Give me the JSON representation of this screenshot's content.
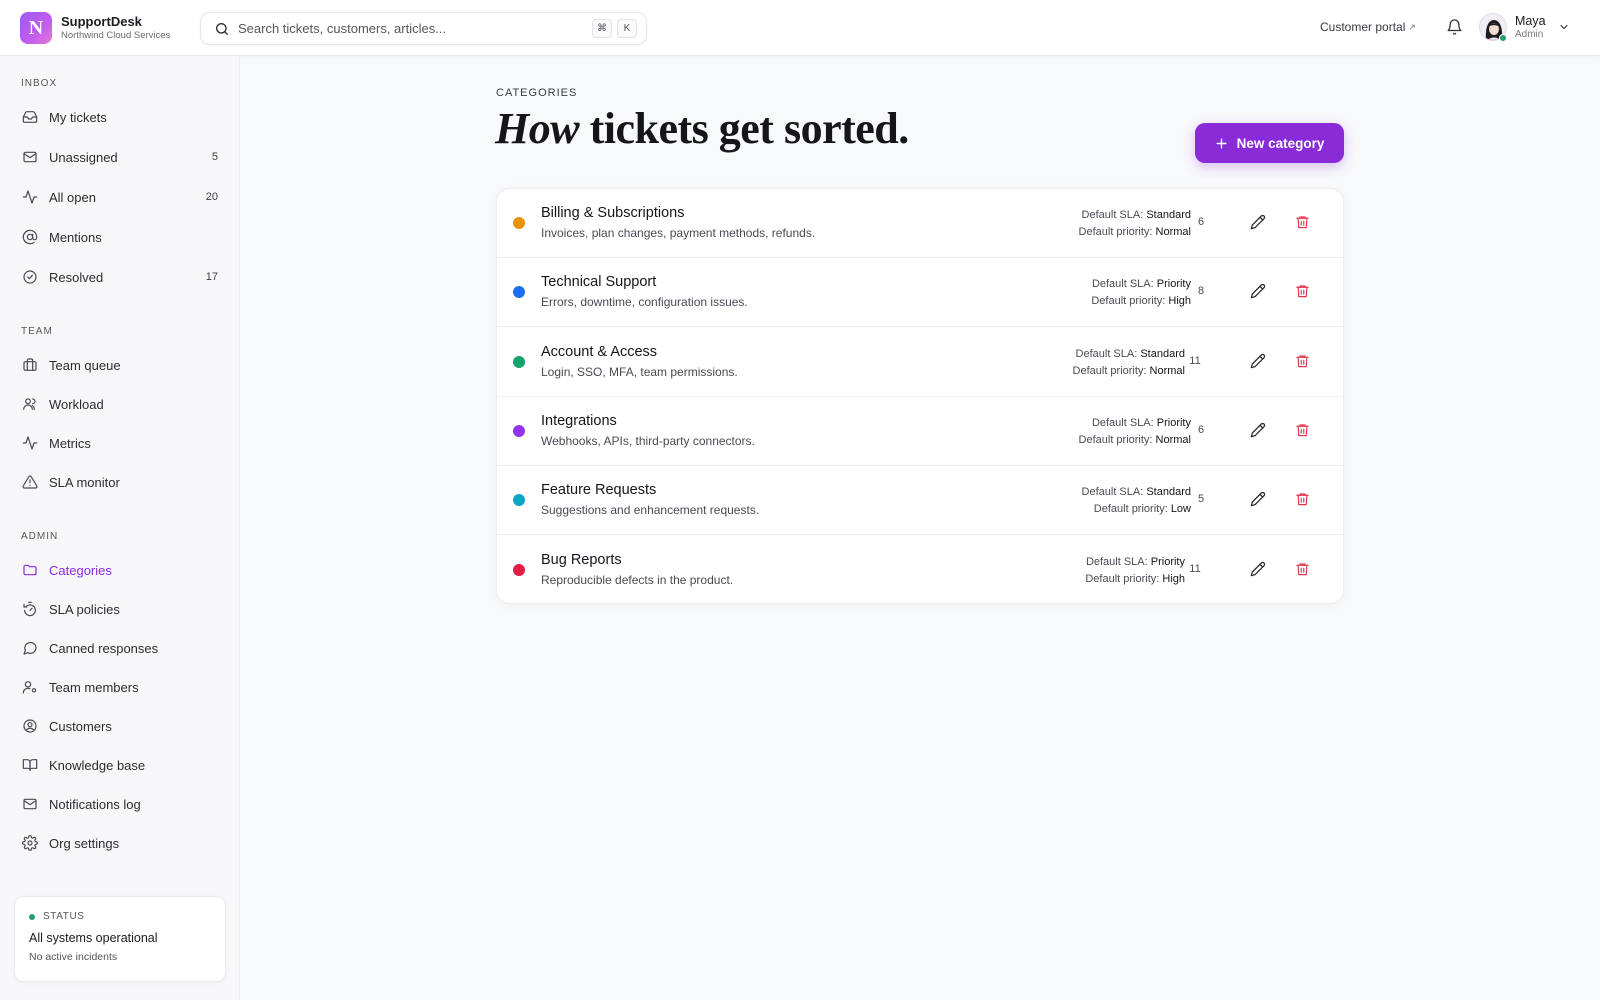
{
  "brand": {
    "logo_letter": "N",
    "name": "SupportDesk",
    "org": "Northwind Cloud Services"
  },
  "search": {
    "placeholder": "Search tickets, customers, articles...",
    "shortcut_cmd": "⌘",
    "shortcut_key": "K"
  },
  "header": {
    "portal_label": "Customer portal",
    "portal_icon": "external-link-arrow",
    "user": {
      "name": "Maya",
      "role": "Admin",
      "online_color": "#22a06b"
    }
  },
  "sidebar": {
    "inbox_label": "INBOX",
    "inbox": [
      {
        "label": "My tickets",
        "icon": "inbox-icon",
        "count": ""
      },
      {
        "label": "Unassigned",
        "icon": "mail-icon",
        "count": "5"
      },
      {
        "label": "All open",
        "icon": "activity-icon",
        "count": "20"
      },
      {
        "label": "Mentions",
        "icon": "at-sign-icon",
        "count": ""
      },
      {
        "label": "Resolved",
        "icon": "check-circle-icon",
        "count": "17"
      }
    ],
    "team_label": "TEAM",
    "team": [
      {
        "label": "Team queue",
        "icon": "briefcase-icon"
      },
      {
        "label": "Workload",
        "icon": "users-icon"
      },
      {
        "label": "Metrics",
        "icon": "pulse-icon"
      },
      {
        "label": "SLA monitor",
        "icon": "alert-triangle-icon"
      }
    ],
    "admin_label": "ADMIN",
    "admin": [
      {
        "label": "Categories",
        "icon": "folder-icon",
        "active": true
      },
      {
        "label": "SLA policies",
        "icon": "timer-icon"
      },
      {
        "label": "Canned responses",
        "icon": "message-circle-icon"
      },
      {
        "label": "Team members",
        "icon": "user-cog-icon"
      },
      {
        "label": "Customers",
        "icon": "user-circle-icon"
      },
      {
        "label": "Knowledge base",
        "icon": "book-open-icon"
      },
      {
        "label": "Notifications log",
        "icon": "mail-log-icon"
      },
      {
        "label": "Org settings",
        "icon": "gear-icon"
      }
    ],
    "status": {
      "label": "STATUS",
      "title": "All systems operational",
      "subtitle": "No active incidents",
      "color": "#22a06b"
    }
  },
  "main": {
    "eyebrow": "CATEGORIES",
    "title_em": "How",
    "title_rest": " tickets get sorted.",
    "new_button": "New category",
    "accent": "#8a2bd8",
    "sla_label": "Default SLA: ",
    "priority_label": "Default priority: ",
    "categories": [
      {
        "name": "Billing & Subscriptions",
        "desc": "Invoices, plan changes, payment methods, refunds.",
        "color": "#e8930c",
        "sla": "Standard",
        "priority": "Normal",
        "count": "6"
      },
      {
        "name": "Technical Support",
        "desc": "Errors, downtime, configuration issues.",
        "color": "#1d6ff2",
        "sla": "Priority",
        "priority": "High",
        "count": "8"
      },
      {
        "name": "Account & Access",
        "desc": "Login, SSO, MFA, team permissions.",
        "color": "#16a36b",
        "sla": "Standard",
        "priority": "Normal",
        "count": "11"
      },
      {
        "name": "Integrations",
        "desc": "Webhooks, APIs, third-party connectors.",
        "color": "#9333ea",
        "sla": "Priority",
        "priority": "Normal",
        "count": "6"
      },
      {
        "name": "Feature Requests",
        "desc": "Suggestions and enhancement requests.",
        "color": "#0ea5c6",
        "sla": "Standard",
        "priority": "Low",
        "count": "5"
      },
      {
        "name": "Bug Reports",
        "desc": "Reproducible defects in the product.",
        "color": "#e11d48",
        "sla": "Priority",
        "priority": "High",
        "count": "11"
      }
    ]
  }
}
